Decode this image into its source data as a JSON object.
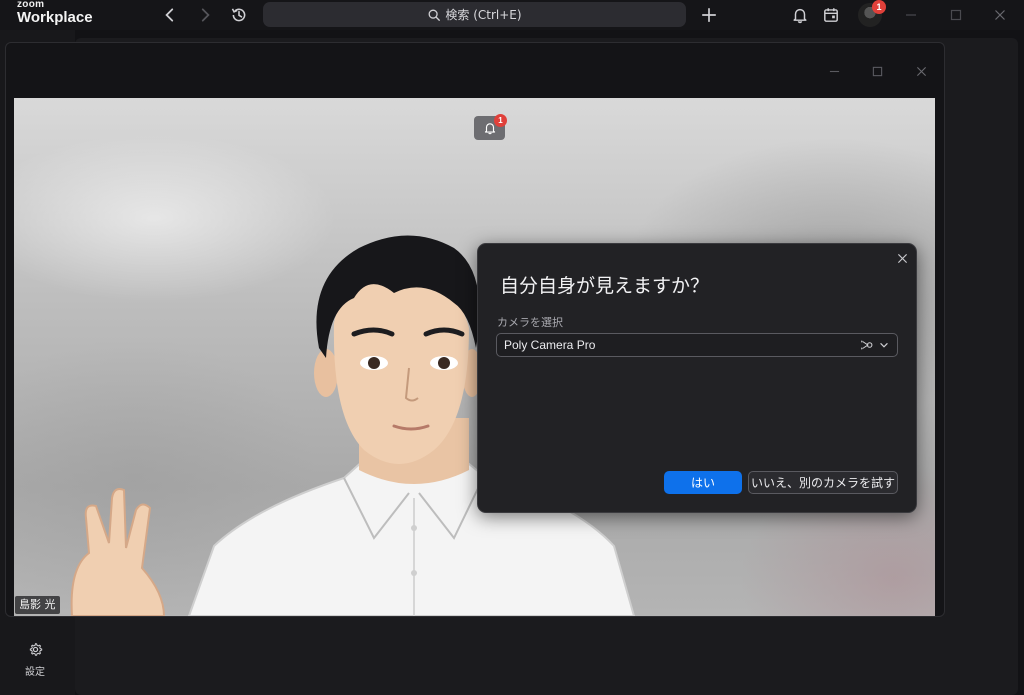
{
  "app": {
    "logo_small": "zoom",
    "logo_big": "Workplace"
  },
  "topbar": {
    "search_placeholder": "検索 (Ctrl+E)",
    "avatar_badge": "1"
  },
  "sidebar": {
    "settings_label": "設定"
  },
  "meeting": {
    "notification_badge": "1",
    "participant_name": "島影 光"
  },
  "dialog": {
    "title": "自分自身が見えますか？",
    "camera_label": "カメラを選択",
    "camera_value": "Poly Camera Pro",
    "yes_button": "はい",
    "no_button": "いいえ、別のカメラを試す"
  },
  "colors": {
    "accent": "#0e71eb",
    "badge": "#e0403a",
    "background": "#121215"
  }
}
